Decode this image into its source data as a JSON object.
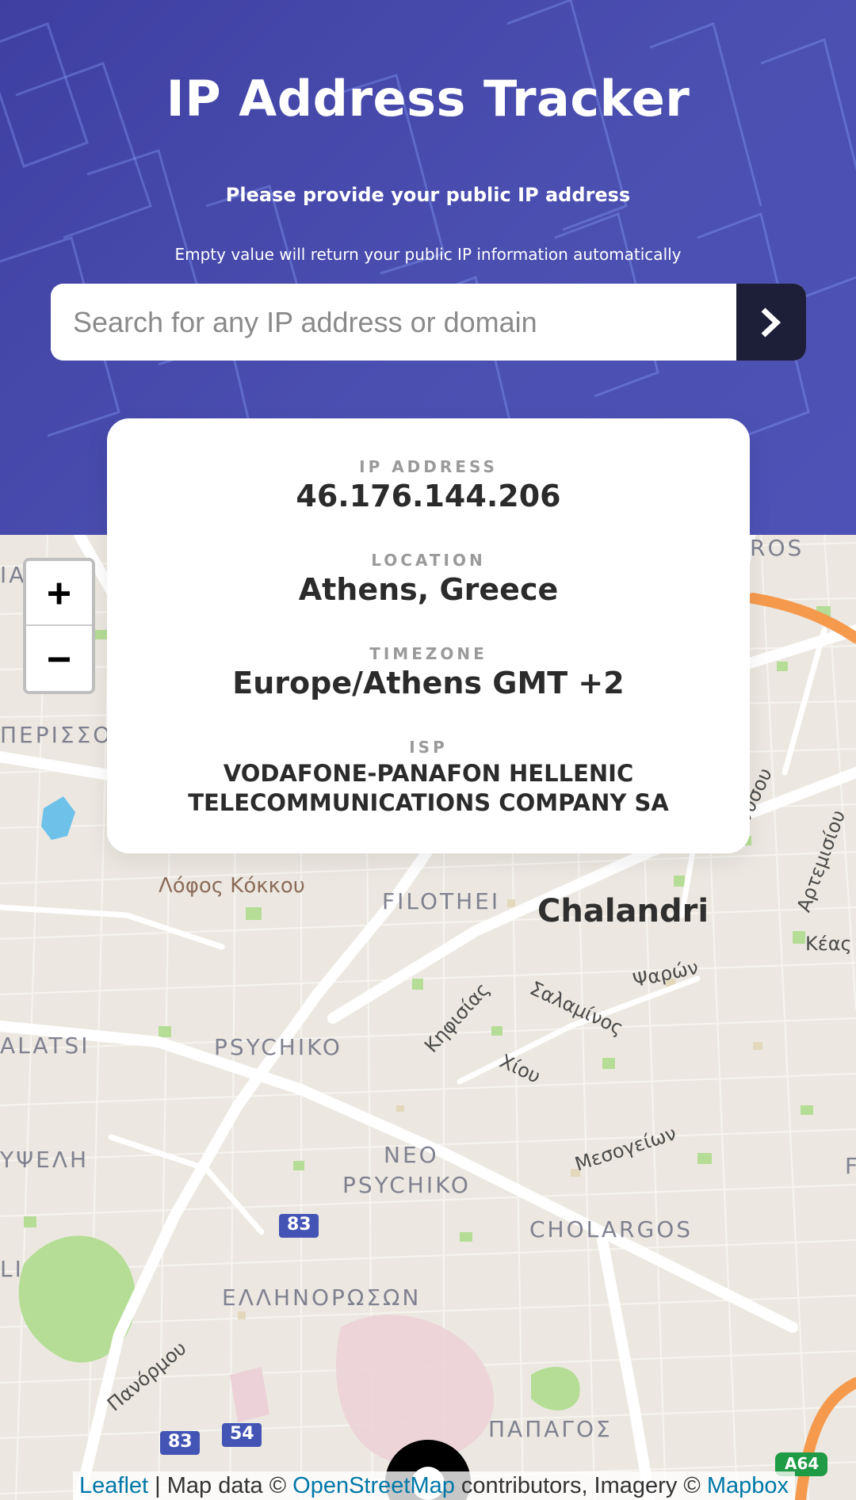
{
  "header": {
    "title": "IP Address Tracker",
    "subtitle": "Please provide your public IP address",
    "hint": "Empty value will return your public IP information automatically"
  },
  "search": {
    "placeholder": "Search for any IP address or domain",
    "value": "",
    "button_icon": "chevron-right-icon"
  },
  "info": {
    "ip_label": "IP ADDRESS",
    "ip_value": "46.176.144.206",
    "location_label": "LOCATION",
    "location_value": "Athens, Greece",
    "timezone_label": "TIMEZONE",
    "timezone_value": "Europe/Athens GMT +2",
    "isp_label": "ISP",
    "isp_value": "VODAFONE-PANAFON HELLENIC TELECOMMUNICATIONS COMPANY SA"
  },
  "map": {
    "zoom_in": "+",
    "zoom_out": "−",
    "marker_icon": "location-pin-icon",
    "labels": {
      "ros": "ROS",
      "ia": "IA",
      "perissos": "ΠΕΡΙΣΣΟΣ",
      "lofos": "Λόφος Κόκκου",
      "filothei": "FILOTHEI",
      "chalandri": "Chalandri",
      "dionysou": "Διονύσου",
      "artemidos": "Αρτεμισίου",
      "keas": "Κέας",
      "psaron": "Ψαρών",
      "salaminos": "Σαλαμίνος",
      "kifisias": "Κηφισίας",
      "alatsi": "ALATSI",
      "psychiko": "PSYCHIKO",
      "chiou": "Χίου",
      "ypseli": "ΥΨΕΛΗ",
      "neo_psychiko_1": "NEO",
      "neo_psychiko_2": "PSYCHIKO",
      "mesogeion": "Μεσογείων",
      "cholargos": "CHOLARGOS",
      "li": "LI",
      "route_83a": "83",
      "ellinoroson": "ΕΛΛΗΝΟΡΩΣΩΝ",
      "panormou": "Πανόρμου",
      "route_83b": "83",
      "route_54": "54",
      "papagos": "ΠΑΠΑΓΟΣ",
      "route_a64": "A64",
      "edge_f": "F"
    },
    "attribution": {
      "leaflet": "Leaflet",
      "sep": "|",
      "map_data": " Map data © ",
      "osm": "OpenStreetMap",
      "contrib": " contributors, Imagery © ",
      "mapbox": "Mapbox"
    },
    "colors": {
      "park": "#b5dd95",
      "motorway": "#f59a4d",
      "road": "#ffffff",
      "land": "#ece8e1"
    }
  },
  "colors": {
    "header_bg": "#4b4fb0",
    "button_bg": "#1d1f39",
    "link": "#0078a8"
  }
}
